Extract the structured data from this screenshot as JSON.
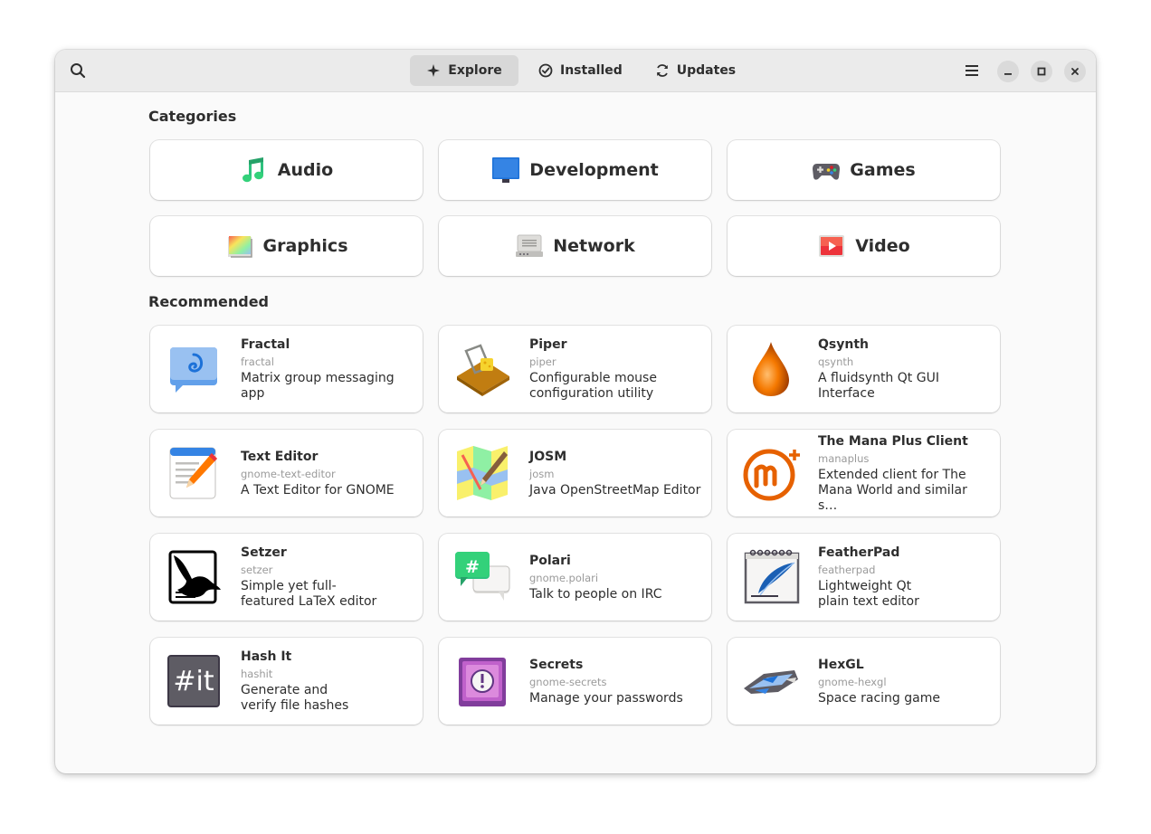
{
  "tabs": [
    {
      "label": "Explore",
      "icon": "explore-icon",
      "active": true
    },
    {
      "label": "Installed",
      "icon": "installed-check-icon",
      "active": false
    },
    {
      "label": "Updates",
      "icon": "updates-refresh-icon",
      "active": false
    }
  ],
  "sections": {
    "categories_title": "Categories",
    "recommended_title": "Recommended"
  },
  "categories": [
    {
      "label": "Audio",
      "icon": "audio-note-icon"
    },
    {
      "label": "Development",
      "icon": "development-monitor-icon"
    },
    {
      "label": "Games",
      "icon": "gamepad-icon"
    },
    {
      "label": "Graphics",
      "icon": "graphics-palette-icon"
    },
    {
      "label": "Network",
      "icon": "network-router-icon"
    },
    {
      "label": "Video",
      "icon": "video-play-icon"
    }
  ],
  "recommended": [
    {
      "name": "Fractal",
      "id": "fractal",
      "desc": "Matrix group messaging app",
      "icon": "fractal-icon"
    },
    {
      "name": "Piper",
      "id": "piper",
      "desc": "Configurable mouse\nconfiguration utility",
      "icon": "piper-mousetrap-icon"
    },
    {
      "name": "Qsynth",
      "id": "qsynth",
      "desc": "A fluidsynth Qt GUI Interface",
      "icon": "qsynth-drop-icon"
    },
    {
      "name": "Text Editor",
      "id": "gnome-text-editor",
      "desc": "A Text Editor for GNOME",
      "icon": "text-editor-icon"
    },
    {
      "name": "JOSM",
      "id": "josm",
      "desc": "Java OpenStreetMap Editor",
      "icon": "josm-map-icon"
    },
    {
      "name": "The Mana Plus Client",
      "id": "manaplus",
      "desc": "Extended client for The\nMana World and similar s…",
      "icon": "manaplus-icon"
    },
    {
      "name": "Setzer",
      "id": "setzer",
      "desc": "Simple yet full-\nfeatured LaTeX editor",
      "icon": "setzer-bird-icon"
    },
    {
      "name": "Polari",
      "id": "gnome.polari",
      "desc": "Talk to people on IRC",
      "icon": "polari-chat-icon"
    },
    {
      "name": "FeatherPad",
      "id": "featherpad",
      "desc": "Lightweight Qt\nplain text editor",
      "icon": "featherpad-quill-icon"
    },
    {
      "name": "Hash It",
      "id": "hashit",
      "desc": "Generate and\nverify file hashes",
      "icon": "hashit-icon"
    },
    {
      "name": "Secrets",
      "id": "gnome-secrets",
      "desc": "Manage your passwords",
      "icon": "secrets-vault-icon"
    },
    {
      "name": "HexGL",
      "id": "gnome-hexgl",
      "desc": "Space racing game",
      "icon": "hexgl-ship-icon"
    }
  ],
  "hashit_glyph": "#it",
  "polari_glyph": "#"
}
